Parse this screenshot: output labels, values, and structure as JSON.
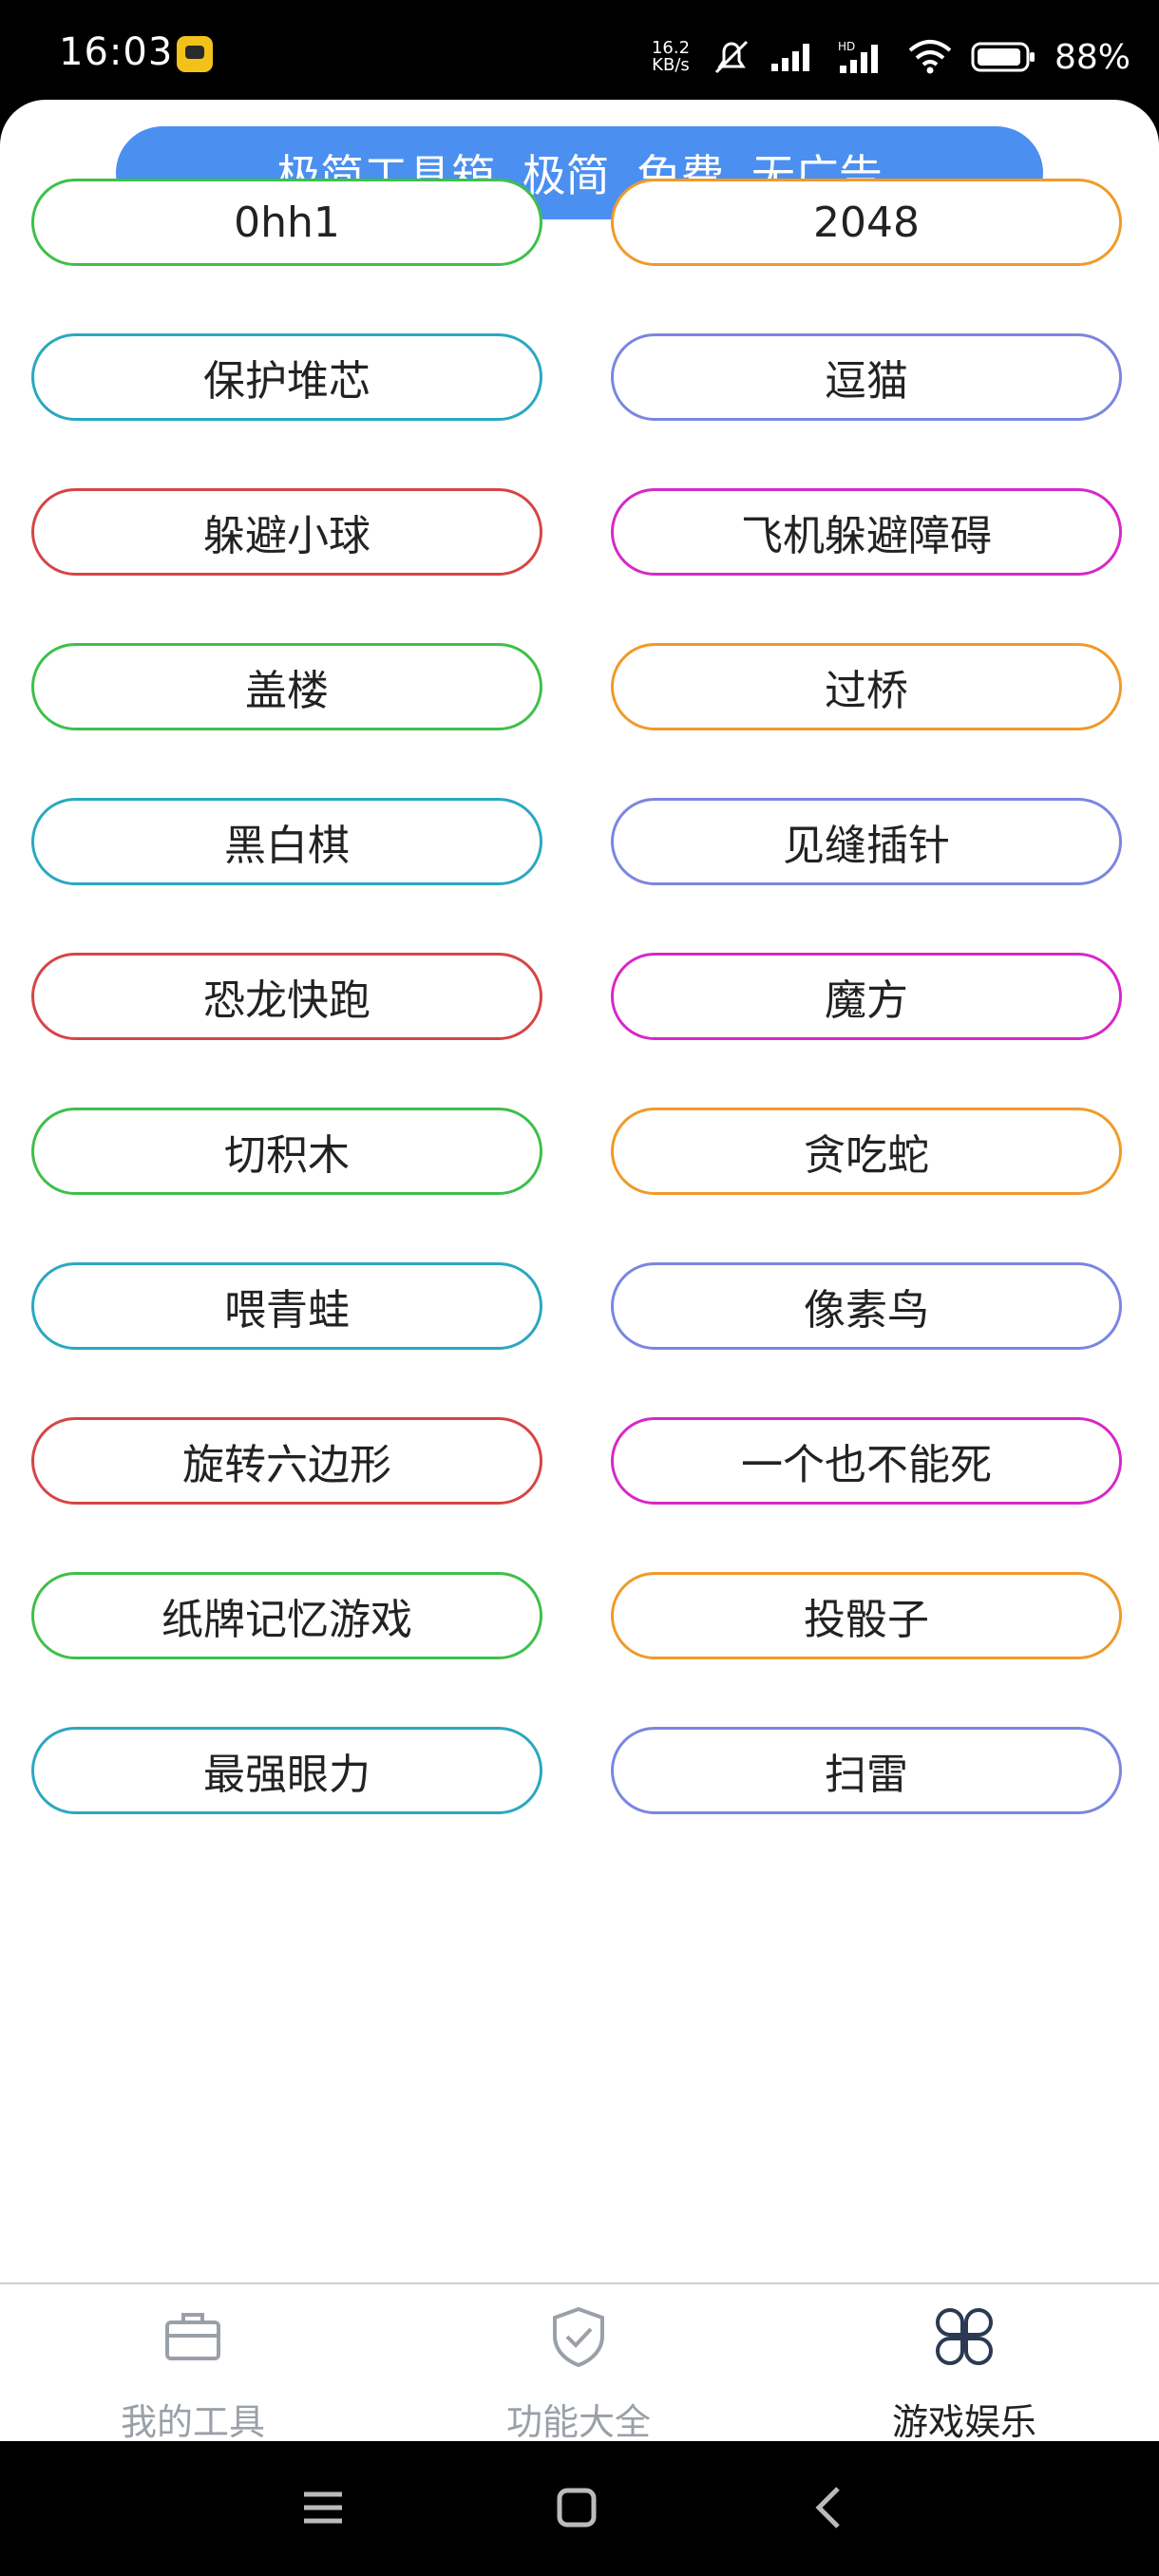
{
  "status_bar": {
    "time": "16:03",
    "net_speed_value": "16.2",
    "net_speed_unit": "KB/s",
    "battery_percent": "88%"
  },
  "banner": {
    "text": "极简工具箱  极简 免费 无广告"
  },
  "games": [
    {
      "label": "0hh1",
      "color": "#3dc04a"
    },
    {
      "label": "2048",
      "color": "#f09a2a"
    },
    {
      "label": "保护堆芯",
      "color": "#2aa8c0"
    },
    {
      "label": "逗猫",
      "color": "#7b86e0"
    },
    {
      "label": "躲避小球",
      "color": "#d64545"
    },
    {
      "label": "飞机躲避障碍",
      "color": "#d728c8"
    },
    {
      "label": "盖楼",
      "color": "#3dc04a"
    },
    {
      "label": "过桥",
      "color": "#f09a2a"
    },
    {
      "label": "黑白棋",
      "color": "#2aa8c0"
    },
    {
      "label": "见缝插针",
      "color": "#7b86e0"
    },
    {
      "label": "恐龙快跑",
      "color": "#d64545"
    },
    {
      "label": "魔方",
      "color": "#d728c8"
    },
    {
      "label": "切积木",
      "color": "#3dc04a"
    },
    {
      "label": "贪吃蛇",
      "color": "#f09a2a"
    },
    {
      "label": "喂青蛙",
      "color": "#2aa8c0"
    },
    {
      "label": "像素鸟",
      "color": "#7b86e0"
    },
    {
      "label": "旋转六边形",
      "color": "#d64545"
    },
    {
      "label": "一个也不能死",
      "color": "#d728c8"
    },
    {
      "label": "纸牌记忆游戏",
      "color": "#3dc04a"
    },
    {
      "label": "投骰子",
      "color": "#f09a2a"
    },
    {
      "label": "最强眼力",
      "color": "#2aa8c0"
    },
    {
      "label": "扫雷",
      "color": "#7b86e0"
    }
  ],
  "tabs": [
    {
      "label": "我的工具",
      "icon": "briefcase-icon",
      "active": false
    },
    {
      "label": "功能大全",
      "icon": "shield-check-icon",
      "active": false
    },
    {
      "label": "游戏娱乐",
      "icon": "four-petal-icon",
      "active": true
    }
  ],
  "colors": {
    "accent": "#4b8ff0",
    "tab_inactive": "#9aa0a8",
    "tab_active": "#222222"
  }
}
